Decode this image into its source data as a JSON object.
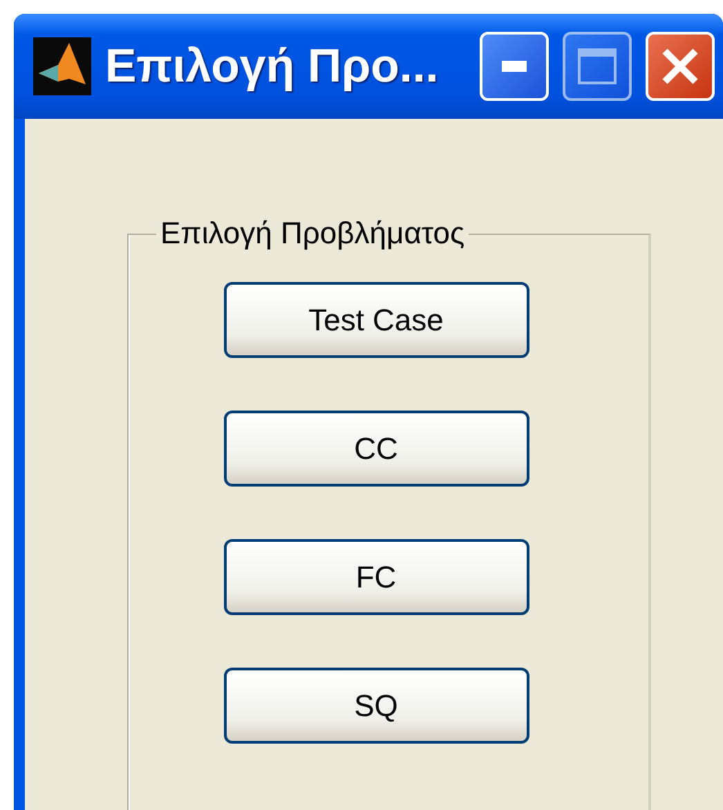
{
  "window": {
    "title": "Επιλογή Προ..."
  },
  "group": {
    "title": "Επιλογή Προβλήματος"
  },
  "buttons": [
    "Test Case",
    "CC",
    "FC",
    "SQ"
  ]
}
